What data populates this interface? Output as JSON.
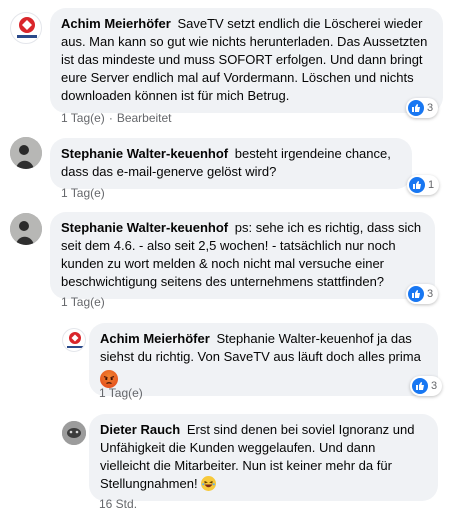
{
  "comments": [
    {
      "author": "Achim Meierhöfer",
      "text": "SaveTV setzt endlich die Löscherei wieder aus. Man kann so gut wie nichts herunterladen. Das Aussetzten ist das mindeste und muss SOFORT erfolgen. Und dann bringt eure Server endlich mal auf Vordermann. Löschen und nichts downloaden können ist für mich Betrug.",
      "time": "1 Tag(e)",
      "edited": "Bearbeitet",
      "reactions": "3"
    },
    {
      "author": "Stephanie Walter-keuenhof",
      "text": "besteht irgendeine chance, dass das e-mail-generve gelöst wird?",
      "time": "1 Tag(e)",
      "reactions": "1"
    },
    {
      "author": "Stephanie Walter-keuenhof",
      "text": "ps: sehe ich es richtig, dass sich seit dem 4.6. - also seit 2,5 wochen! - tatsächlich nur noch kunden zu wort melden & noch nicht mal versuche einer beschwichtigung seitens des unternehmens stattfinden?",
      "time": "1 Tag(e)",
      "reactions": "3"
    }
  ],
  "replies": [
    {
      "author": "Achim Meierhöfer",
      "text": "Stephanie Walter-keuenhof ja das siehst du richtig. Von SaveTV aus läuft doch alles prima",
      "time": "1 Tag(e)",
      "reactions": "3",
      "emoji": "angry-face"
    },
    {
      "author": "Dieter Rauch",
      "text": "Erst sind denen bei soviel Ignoranz und Unfähigkeit die Kunden weggelaufen. Und dann vielleicht die Mitarbeiter. Nun ist keiner mehr da für Stellungnahmen!",
      "time": "16 Std.",
      "emoji": "laughing-emoji"
    }
  ],
  "colors": {
    "bubble": "#f0f2f5",
    "like": "#1877f2",
    "meta": "#65676b"
  }
}
